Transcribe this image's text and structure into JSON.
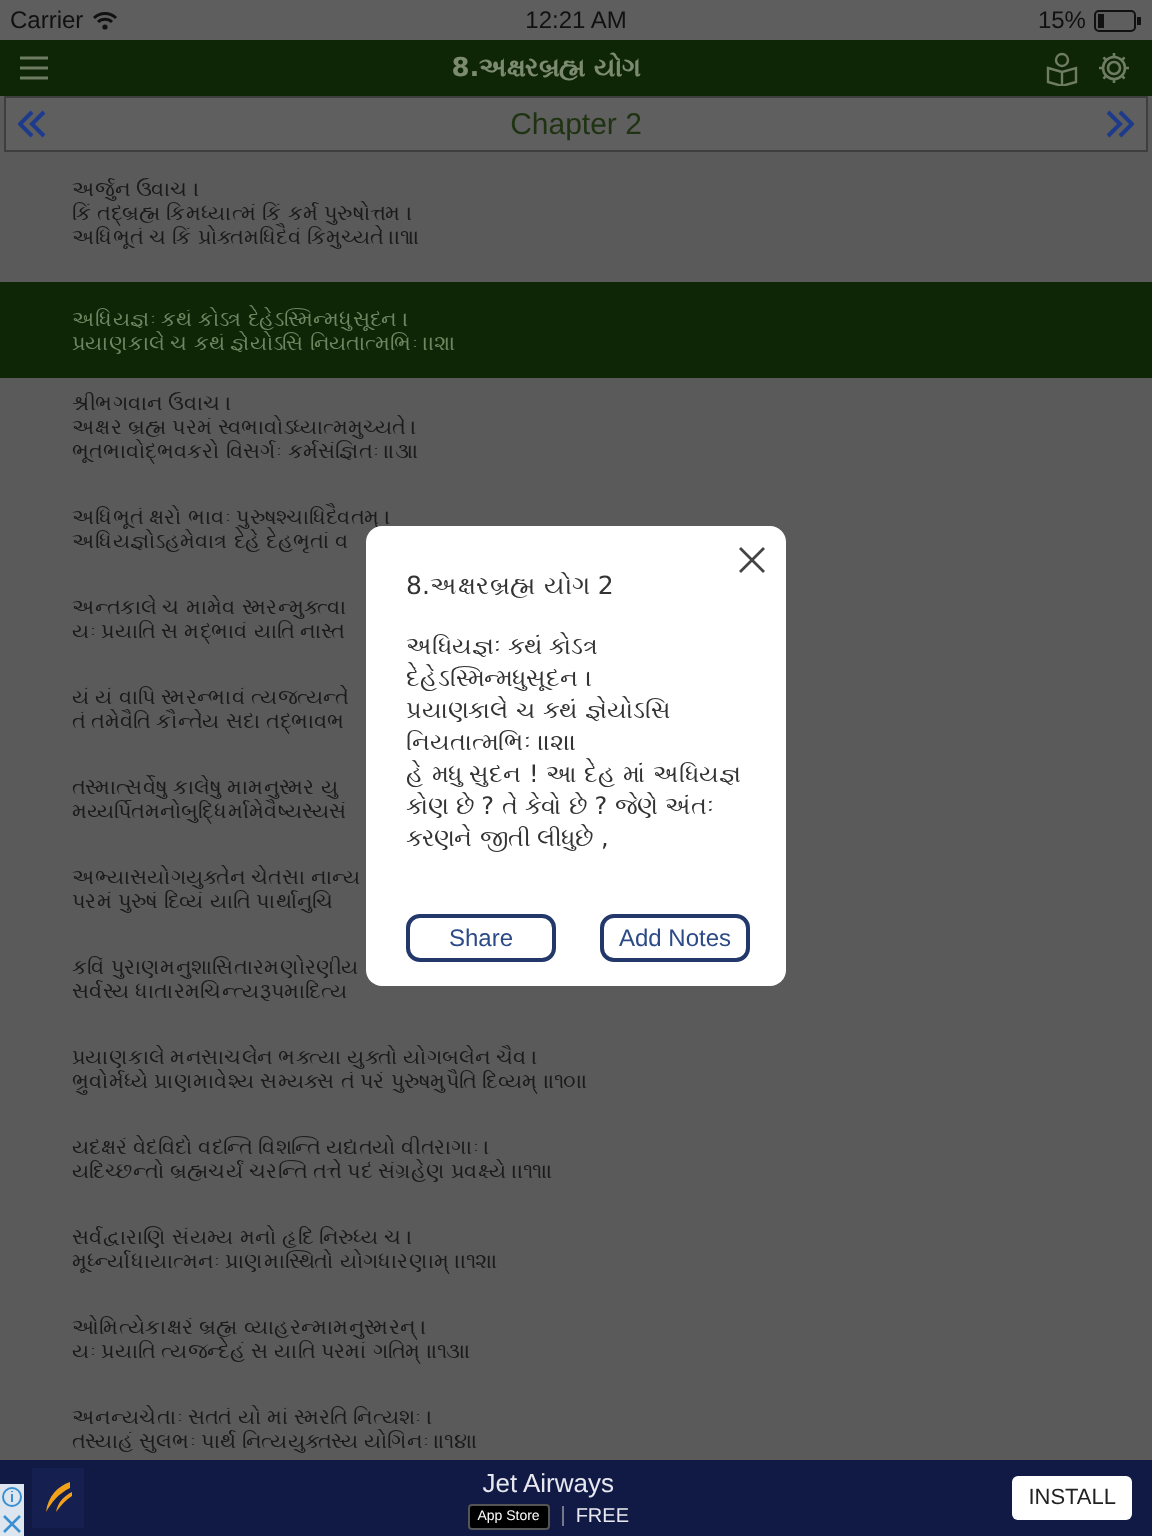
{
  "status_bar": {
    "carrier": "Carrier",
    "time": "12:21 AM",
    "battery": "15%"
  },
  "header": {
    "title": "8.અક્ષરબ્રહ્મ યોગ"
  },
  "chapter_nav": {
    "label": "Chapter 2"
  },
  "verses": [
    {
      "lines": [
        "અર્જુન ઉવાચ ।",
        "કિં તદ્બ્રહ્મ કિમધ્યાત્મં કિં કર્મ પુરુષોત્તમ ।",
        "અધિભૂતં ચ કિં પ્રોક્તમધિદૈવં કિમુચ્યતે ।।૧।।"
      ],
      "selected": false
    },
    {
      "lines": [
        "અધિયજ્ઞઃ કથં કોઽત્ર દેહેઽસ્મિન્મધુસૂદન ।",
        "પ્રયાણકાલે ચ કથં જ્ઞેયોઽસિ નિયતાત્મભિઃ ।।૨।।"
      ],
      "selected": true
    },
    {
      "lines": [
        "શ્રીભગવાન ઉવાચ ।",
        "અક્ષર બ્રહ્મ પરમં સ્વભાવોઽધ્યાત્મમુચ્યતે ।",
        "ભૂતભાવોદ્ભવકરો વિસર્ગઃ કર્મસંજ્ઞિતઃ ।।૩।।"
      ],
      "selected": false
    },
    {
      "lines": [
        "અધિભૂતં ક્ષરો ભાવઃ પુરુષશ્ચાધિદૈવતમ્ ।",
        "અધિયજ્ઞોઽહમેવાત્ર દેહે દેહભૃતાં વ"
      ],
      "selected": false
    },
    {
      "lines": [
        "અન્તકાલે ચ મામેવ સ્મરન્મુક્ત્વા",
        "યઃ પ્રયાતિ સ મદ્ભાવં યાતિ નાસ્ત"
      ],
      "selected": false
    },
    {
      "lines": [
        "યં યં વાપિ સ્મરન્ભાવં ત્યજત્યન્તે",
        "તં તમેવૈતિ કૌન્તેય સદા તદ્ભાવભ"
      ],
      "selected": false
    },
    {
      "lines": [
        "તસ્માત્સર્વેષુ કાલેષુ મામનુસ્મર યુ",
        "મય્યર્પિતમનોબુદ્ધિર્મામેવૈષ્યસ્યસં"
      ],
      "selected": false
    },
    {
      "lines": [
        "અભ્યાસયોગયુક્તેન ચેતસા નાન્ય",
        "પરમં પુરુષં દિવ્યં યાતિ પાર્થાનુચિ"
      ],
      "selected": false
    },
    {
      "lines": [
        "કવિં પુરાણમનુશાસિતારમણોરણીય",
        "સર્વસ્ય ધાતારમચિન્ત્યરૂપમાદિત્ય"
      ],
      "selected": false
    },
    {
      "lines": [
        "પ્રયાણકાલે મનસાચલેન ભક્ત્યા યુક્તો યોગબલેન ચૈવ ।",
        "ભ્રુવોર્મધ્યે પ્રાણમાવેશ્ય સમ્યક્સ તં પરં પુરુષમુપૈતિ દિવ્યમ્ ।।૧૦।।"
      ],
      "selected": false
    },
    {
      "lines": [
        "યદક્ષરં વેદવિદો વદન્તિ વિશન્તિ યદ્યતયો વીતરાગાઃ ।",
        "યદિચ્છન્તો બ્રહ્મચર્યં ચરન્તિ તત્તે પદં સંગ્રહેણ પ્રવક્ષ્યે ।।૧૧।।"
      ],
      "selected": false
    },
    {
      "lines": [
        "સર્વદ્વારાણિ સંયમ્ય મનો હૃદિ નિરુધ્ય ચ ।",
        "મૂર્ધ્ન્યાધાયાત્મનઃ પ્રાણમાસ્થિતો યોગધારણામ્ ।।૧૨।।"
      ],
      "selected": false
    },
    {
      "lines": [
        "ઓમિત્યેકાક્ષરં બ્રહ્મ વ્યાહરન્મામનુસ્મરન્ ।",
        "યઃ પ્રયાતિ ત્યજન્દેહં સ યાતિ પરમાં ગતિમ્ ।।૧૩।।"
      ],
      "selected": false
    },
    {
      "lines": [
        "અનન્યચેતાઃ સતતં યો માં સ્મરતિ નિત્યશઃ ।",
        "તસ્યાહં સુલભઃ પાર્થ નિત્યયુક્તસ્ય યોગિનઃ ।।૧૪।।"
      ],
      "selected": false
    }
  ],
  "dialog": {
    "title": "8.અક્ષરબ્રહ્મ યોગ 2",
    "verse_lines": [
      "અધિયજ્ઞઃ કથં કોઽત્ર",
      "દેહેઽસ્મિન્મધુસૂદન ।",
      "પ્રયાણકાલે ચ કથં જ્ઞેયોઽસિ",
      "નિયતાત્મભિઃ ।।૨।।"
    ],
    "meaning": "હે મધુ સુદન ! આ દેહ માં અધિયજ્ઞ કોણ છે ? તે કેવો છે ? જેણે અંતઃ કરણને જીતી લીધુછે ,",
    "buttons": [
      "Share",
      "Add Notes"
    ]
  },
  "ad": {
    "title": "Jet Airways",
    "badge": "App Store",
    "price": "FREE",
    "button": "INSTALL"
  }
}
